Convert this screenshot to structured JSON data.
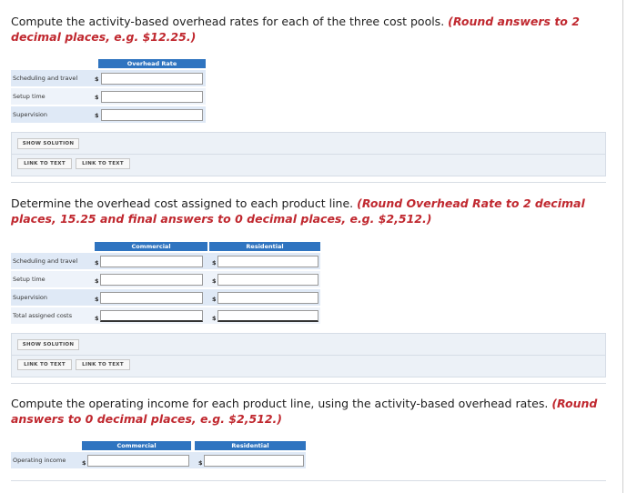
{
  "section1": {
    "question": "Compute the activity-based overhead rates for each of the three cost pools.",
    "hint": "(Round answers to 2 decimal places, e.g. $12.25.)",
    "column_header": "Overhead Rate",
    "rows": [
      {
        "label": "Scheduling and travel",
        "currency": "$",
        "value": ""
      },
      {
        "label": "Setup time",
        "currency": "$",
        "value": ""
      },
      {
        "label": "Supervision",
        "currency": "$",
        "value": ""
      }
    ],
    "show_solution": "SHOW SOLUTION",
    "link1": "LINK TO TEXT",
    "link2": "LINK TO TEXT"
  },
  "section2": {
    "question": "Determine the overhead cost assigned to each product line.",
    "hint": "(Round Overhead Rate to 2 decimal places, 15.25 and final answers to 0 decimal places, e.g. $2,512.)",
    "columns": [
      "Commercial",
      "Residential"
    ],
    "rows": [
      {
        "label": "Scheduling and travel",
        "currency": "$"
      },
      {
        "label": "Setup time",
        "currency": "$"
      },
      {
        "label": "Supervision",
        "currency": "$"
      },
      {
        "label": "Total assigned costs",
        "currency": "$"
      }
    ],
    "show_solution": "SHOW SOLUTION",
    "link1": "LINK TO TEXT",
    "link2": "LINK TO TEXT"
  },
  "section3": {
    "question": "Compute the operating income for each product line, using the activity-based overhead rates.",
    "hint": "(Round answers to 0 decimal places, e.g. $2,512.)",
    "columns": [
      "Commercial",
      "Residential"
    ],
    "rows": [
      {
        "label": "Operating income",
        "currency": "$"
      }
    ]
  }
}
